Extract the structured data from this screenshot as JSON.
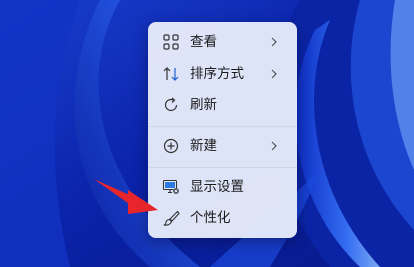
{
  "context_menu": {
    "items": [
      {
        "label": "查看",
        "icon": "view-grid-icon",
        "has_submenu": true
      },
      {
        "label": "排序方式",
        "icon": "sort-icon",
        "has_submenu": true
      },
      {
        "label": "刷新",
        "icon": "refresh-icon",
        "has_submenu": false
      },
      {
        "label": "新建",
        "icon": "new-plus-icon",
        "has_submenu": true
      },
      {
        "label": "显示设置",
        "icon": "display-settings-icon",
        "has_submenu": false
      },
      {
        "label": "个性化",
        "icon": "personalize-brush-icon",
        "has_submenu": false
      }
    ]
  },
  "colors": {
    "wallpaper_dark": "#0a1f9c",
    "wallpaper_light": "#4a8cff",
    "menu_background": "#eef1fb",
    "annotation_arrow": "#e8252a"
  }
}
